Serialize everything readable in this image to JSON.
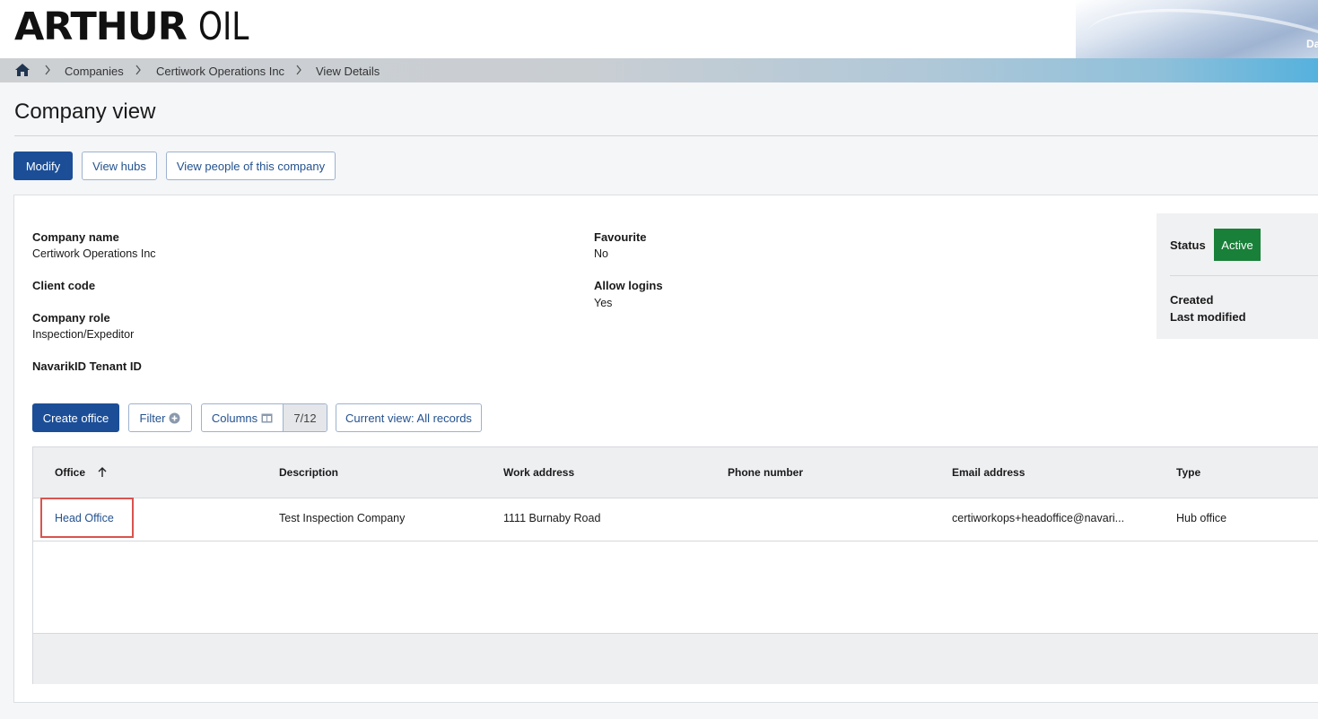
{
  "header": {
    "logo_bold": "ARTHUR",
    "logo_light": "OIL",
    "user_clip": "Da"
  },
  "breadcrumb": {
    "home_icon": "home-icon",
    "items": [
      "Companies",
      "Certiwork Operations Inc",
      "View Details"
    ]
  },
  "page": {
    "title": "Company view"
  },
  "actions": {
    "modify": "Modify",
    "view_hubs": "View hubs",
    "view_people": "View people of this company"
  },
  "details": {
    "company_name_label": "Company name",
    "company_name_value": "Certiwork Operations Inc",
    "client_code_label": "Client code",
    "company_role_label": "Company role",
    "company_role_value": "Inspection/Expeditor",
    "tenant_label": "NavarikID Tenant ID",
    "favourite_label": "Favourite",
    "favourite_value": "No",
    "allow_logins_label": "Allow logins",
    "allow_logins_value": "Yes"
  },
  "status": {
    "label": "Status",
    "value": "Active",
    "color": "#188038",
    "created_label": "Created",
    "modified_label": "Last modified"
  },
  "toolbar": {
    "create_office": "Create office",
    "filter": "Filter",
    "columns": "Columns",
    "columns_count": "7/12",
    "current_view": "Current view: All records"
  },
  "table": {
    "columns": [
      "Office",
      "Description",
      "Work address",
      "Phone number",
      "Email address",
      "Type"
    ],
    "sorted_column": "Office",
    "rows": [
      {
        "office": "Head Office",
        "description": "Test Inspection Company",
        "work_address": "1111 Burnaby Road",
        "phone": "",
        "email": "certiworkops+headoffice@navari...",
        "type": "Hub office"
      }
    ]
  },
  "colors": {
    "primary": "#1b4e97",
    "link": "#24528f",
    "highlight": "#d9534f"
  }
}
